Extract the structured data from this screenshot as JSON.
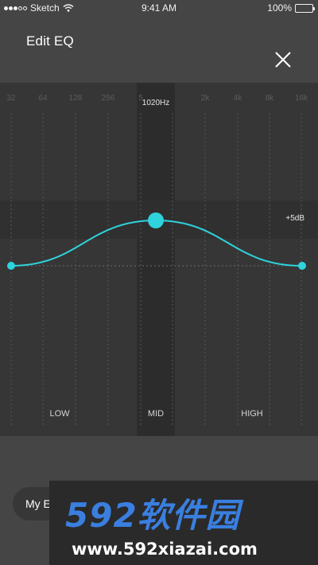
{
  "status": {
    "carrier": "Sketch",
    "time": "9:41 AM",
    "battery": "100%"
  },
  "header": {
    "title": "Edit EQ"
  },
  "eq": {
    "frequencies": [
      "32",
      "64",
      "128",
      "256",
      "5",
      "",
      "2k",
      "4k",
      "8k",
      "16k"
    ],
    "selected_frequency": "1020Hz",
    "gain_label": "+5dB",
    "bands": [
      "LOW",
      "MID",
      "HIGH"
    ],
    "accent_color": "#2ed3dc",
    "curve_gain_db": [
      0,
      5,
      0
    ]
  },
  "bottom": {
    "preset_label": "My E"
  },
  "watermark": {
    "logo": "592软件园",
    "url": "www.592xiazai.com"
  }
}
